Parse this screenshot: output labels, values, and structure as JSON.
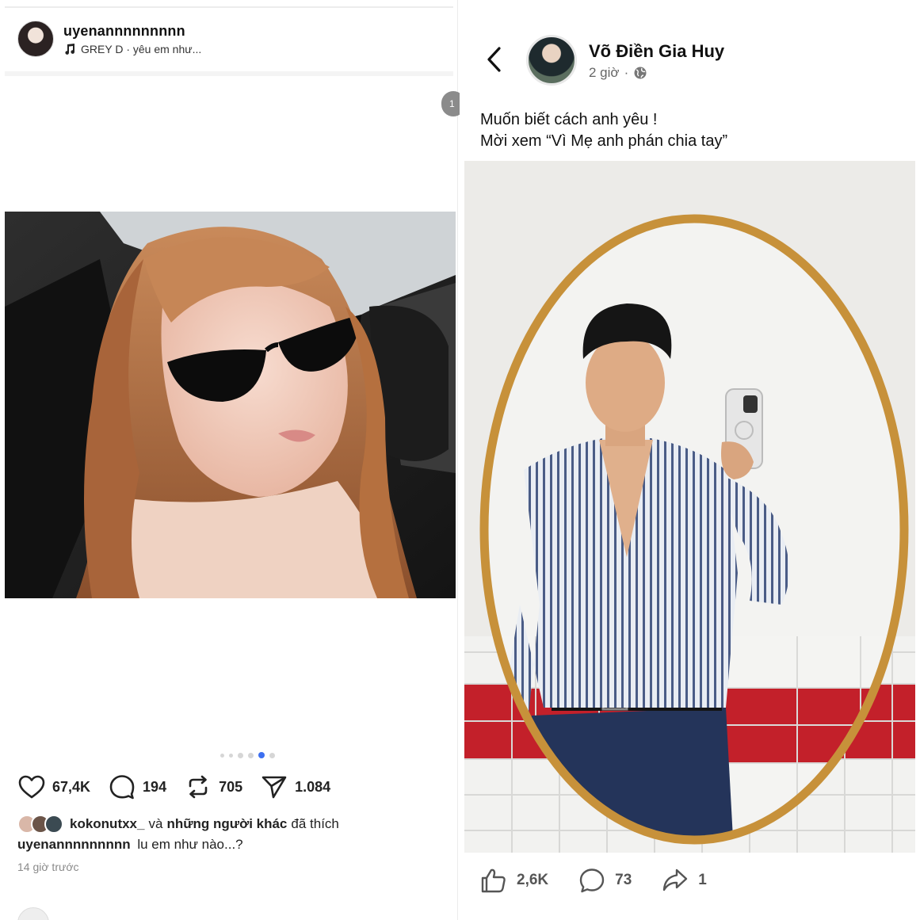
{
  "left_post": {
    "username": "uyenannnnnnnnn",
    "music": "GREY D · yêu em như...",
    "pager_text": "1",
    "carousel": {
      "count": 6,
      "active_index": 4
    },
    "actions": {
      "likes": "67,4K",
      "comments": "194",
      "reposts": "705",
      "shares": "1.084"
    },
    "liked_by": {
      "user": "kokonutxx_",
      "connector": "và",
      "others": "những người khác",
      "suffix": "đã thích"
    },
    "caption": {
      "user": "uyenannnnnnnnn",
      "text": "lu em như nào...?"
    },
    "time": "14 giờ trước"
  },
  "right_post": {
    "name": "Võ Điền Gia Huy",
    "time": "2 giờ",
    "separator": "·",
    "text_line1": "Muốn biết cách anh yêu !",
    "text_line2": "Mời xem “Vì Mẹ anh phán chia tay”",
    "actions": {
      "likes": "2,6K",
      "comments": "73",
      "shares": "1"
    }
  },
  "colors": {
    "accent_dot": "#3d6ff0",
    "mirror_frame": "#c7913a",
    "tile_red": "#c3202a"
  }
}
